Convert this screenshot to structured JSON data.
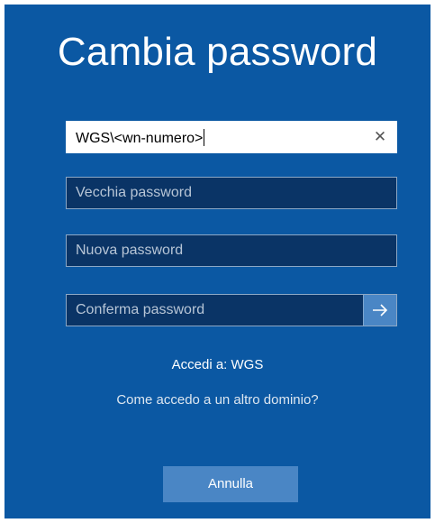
{
  "title": "Cambia password",
  "fields": {
    "username": {
      "value": "WGS\\<wn-numero>",
      "clear_icon": "close-icon"
    },
    "old_password": {
      "placeholder": "Vecchia password"
    },
    "new_password": {
      "placeholder": "Nuova password"
    },
    "confirm_password": {
      "placeholder": "Conferma password",
      "submit_icon": "arrow-right-icon"
    }
  },
  "signin_domain": "Accedi a: WGS",
  "other_domain_link": "Come accedo a un altro dominio?",
  "cancel_label": "Annulla",
  "colors": {
    "background": "#0b58a3",
    "field_dark": "#0a3466",
    "button": "#4a86c5",
    "text": "#ffffff"
  }
}
